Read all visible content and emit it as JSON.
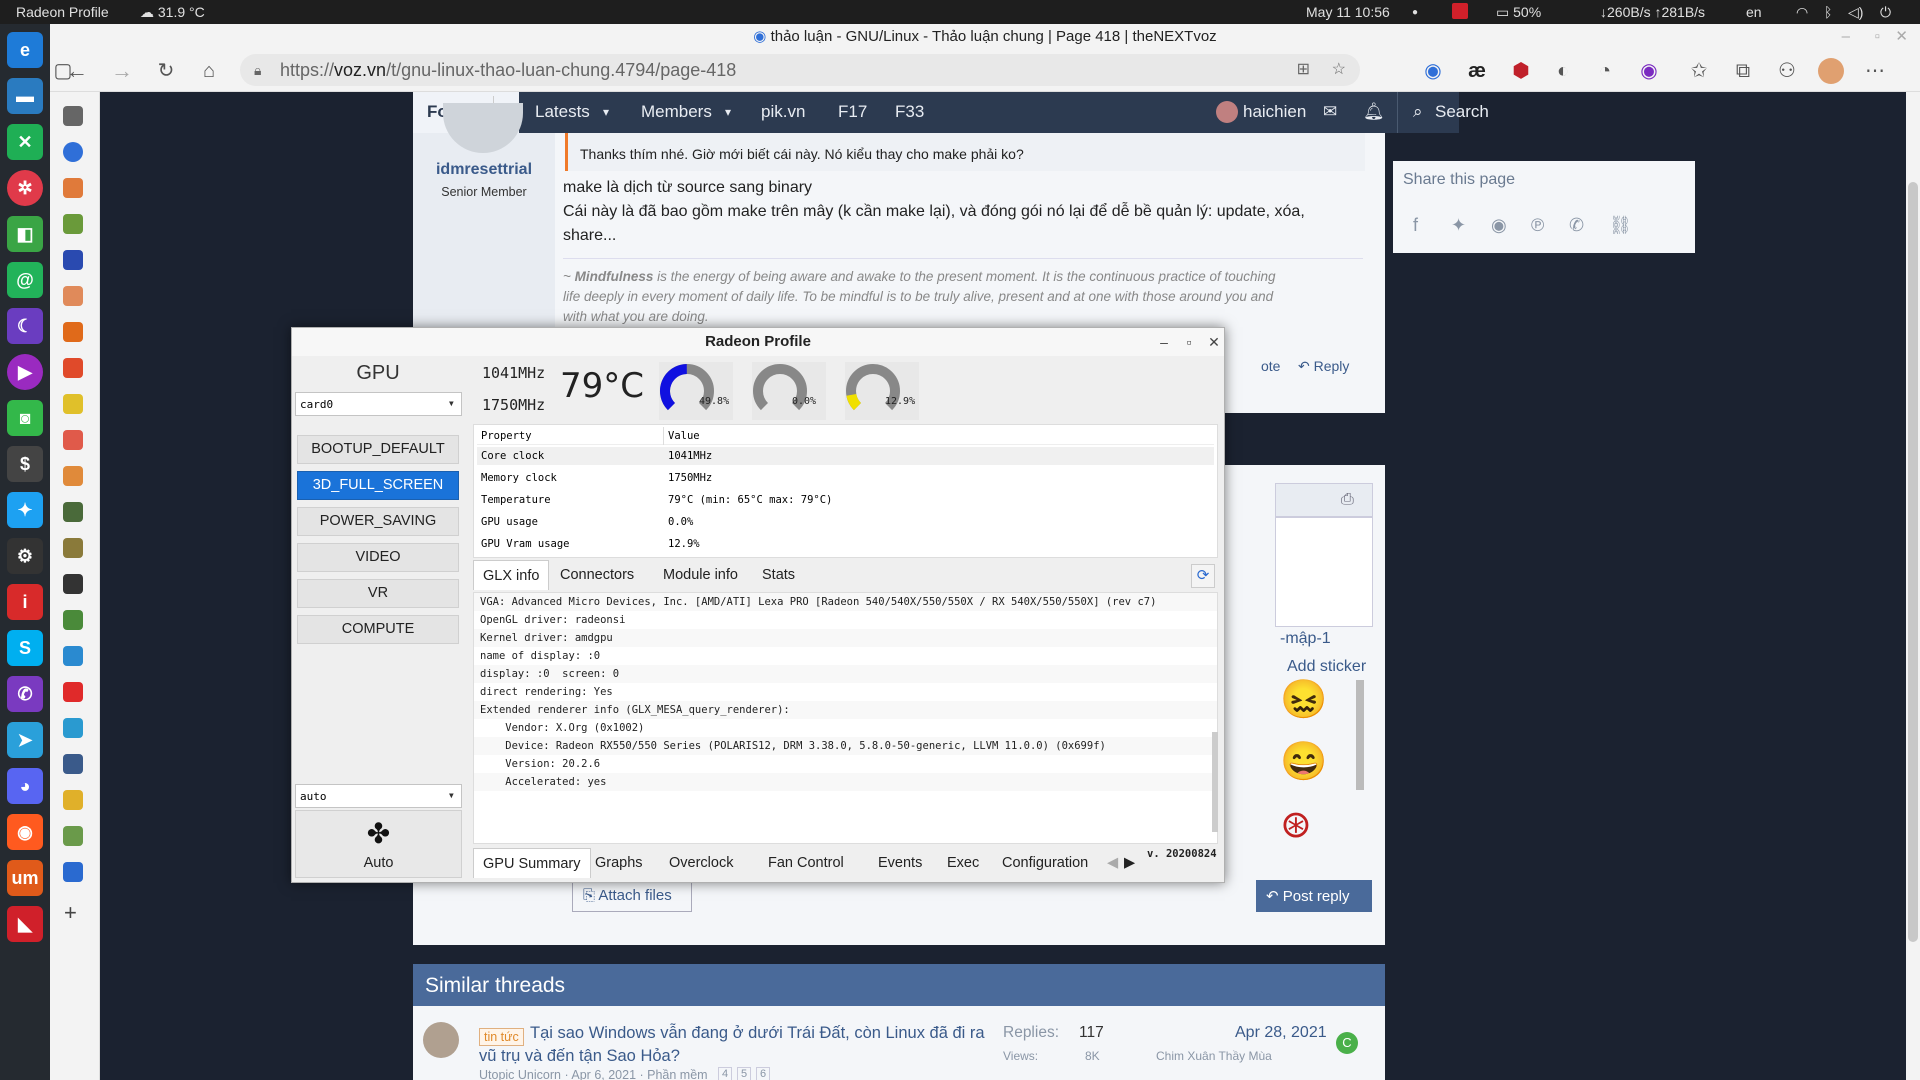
{
  "system_bar": {
    "app_name": "Radeon Profile",
    "weather": "31.9 °C",
    "datetime": "May 11  10:56",
    "battery": "50%",
    "network": "↓260B/s ↑281B/s",
    "language": "en"
  },
  "browser": {
    "title": "thảo luận - GNU/Linux - Thảo luận chung | Page 418 | theNEXTvoz",
    "url_prefix": "https://",
    "url_domain": "voz.vn",
    "url_path": "/t/gnu-linux-thao-luan-chung.4794/page-418"
  },
  "voz": {
    "nav": [
      "Forums",
      "Latests",
      "Members",
      "pik.vn",
      "F17",
      "F33"
    ],
    "username": "haichien",
    "search_label": "Search",
    "post": {
      "author": "idmresettrial",
      "role": "Senior Member",
      "quote": "Thanks thím nhé. Giờ mới biết cái này. Nó kiểu thay cho make phải ko?",
      "line1": "make là dịch từ source sang binary",
      "line2": "Cái này là đã bao gồm make trên mây (k cần make lại), và đóng gói nó lại để dễ bề quản lý: update, xóa,",
      "line3": "share...",
      "sig_prefix": "~ ",
      "sig_bold": "Mindfulness",
      "sig_rest": " is the energy of being aware and awake to the present moment. It is the continuous practice of touching",
      "sig_line2": "life deeply in every moment of daily life. To be mindful is to be truly alive, present and at one with those around you and",
      "sig_line3": "with what you are doing.",
      "quote_action": "ote",
      "reply_action": "Reply"
    },
    "share_title": "Share this page",
    "sticker_label": "-mập-1",
    "add_sticker": "Add sticker",
    "attach_files": "Attach files",
    "post_reply": "Post reply",
    "similar_title": "Similar threads",
    "thread": {
      "tag": "tin tức",
      "title": "Tại sao Windows vẫn đang ở dưới Trái Đất, còn Linux đã đi ra",
      "title2": "vũ trụ và đến tận Sao Hỏa?",
      "meta": "Utopic Unicorn · Apr 6, 2021 · Phần mềm",
      "pages": [
        "4",
        "5",
        "6"
      ],
      "replies_label": "Replies:",
      "replies": "117",
      "views_label": "Views:",
      "views": "8K",
      "date": "Apr 28, 2021",
      "last_user": "Chim Xuân Thầy Mùa",
      "avatar_letter": "C"
    }
  },
  "radeon": {
    "title": "Radeon Profile",
    "gpu_label": "GPU",
    "card": "card0",
    "core_clock": "1041MHz",
    "mem_clock": "1750MHz",
    "temp": "79°C",
    "gauges": [
      {
        "label": "49.8%",
        "value": 49.8,
        "color": "#1010e0"
      },
      {
        "label": "0.0%",
        "value": 0.0,
        "color": "#e0e000"
      },
      {
        "label": "12.9%",
        "value": 12.9,
        "color": "#f0e000"
      }
    ],
    "profiles": [
      "BOOTUP_DEFAULT",
      "3D_FULL_SCREEN",
      "POWER_SAVING",
      "VIDEO",
      "VR",
      "COMPUTE"
    ],
    "selected_profile": "3D_FULL_SCREEN",
    "fan_mode": "auto",
    "fan_label": "Auto",
    "table_headers": [
      "Property",
      "Value"
    ],
    "table_rows": [
      [
        "Core clock",
        "1041MHz"
      ],
      [
        "Memory clock",
        "1750MHz"
      ],
      [
        "Temperature",
        "79°C (min: 65°C max: 79°C)"
      ],
      [
        "GPU usage",
        "0.0%"
      ],
      [
        "GPU Vram usage",
        "12.9%"
      ]
    ],
    "info_tabs": [
      "GLX info",
      "Connectors",
      "Module info",
      "Stats"
    ],
    "glx_lines": [
      "VGA: Advanced Micro Devices, Inc. [AMD/ATI] Lexa PRO [Radeon 540/540X/550/550X / RX 540X/550/550X] (rev c7)",
      "OpenGL driver: radeonsi",
      "Kernel driver: amdgpu",
      "name of display: :0",
      "display: :0  screen: 0",
      "direct rendering: Yes",
      "Extended renderer info (GLX_MESA_query_renderer):",
      "    Vendor: X.Org (0x1002)",
      "    Device: Radeon RX550/550 Series (POLARIS12, DRM 3.38.0, 5.8.0-50-generic, LLVM 11.0.0) (0x699f)",
      "    Version: 20.2.6",
      "    Accelerated: yes"
    ],
    "bottom_tabs": [
      "GPU Summary",
      "Graphs",
      "Overclock",
      "Fan Control",
      "Events",
      "Exec",
      "Configuration"
    ],
    "version": "v. 20200824"
  }
}
